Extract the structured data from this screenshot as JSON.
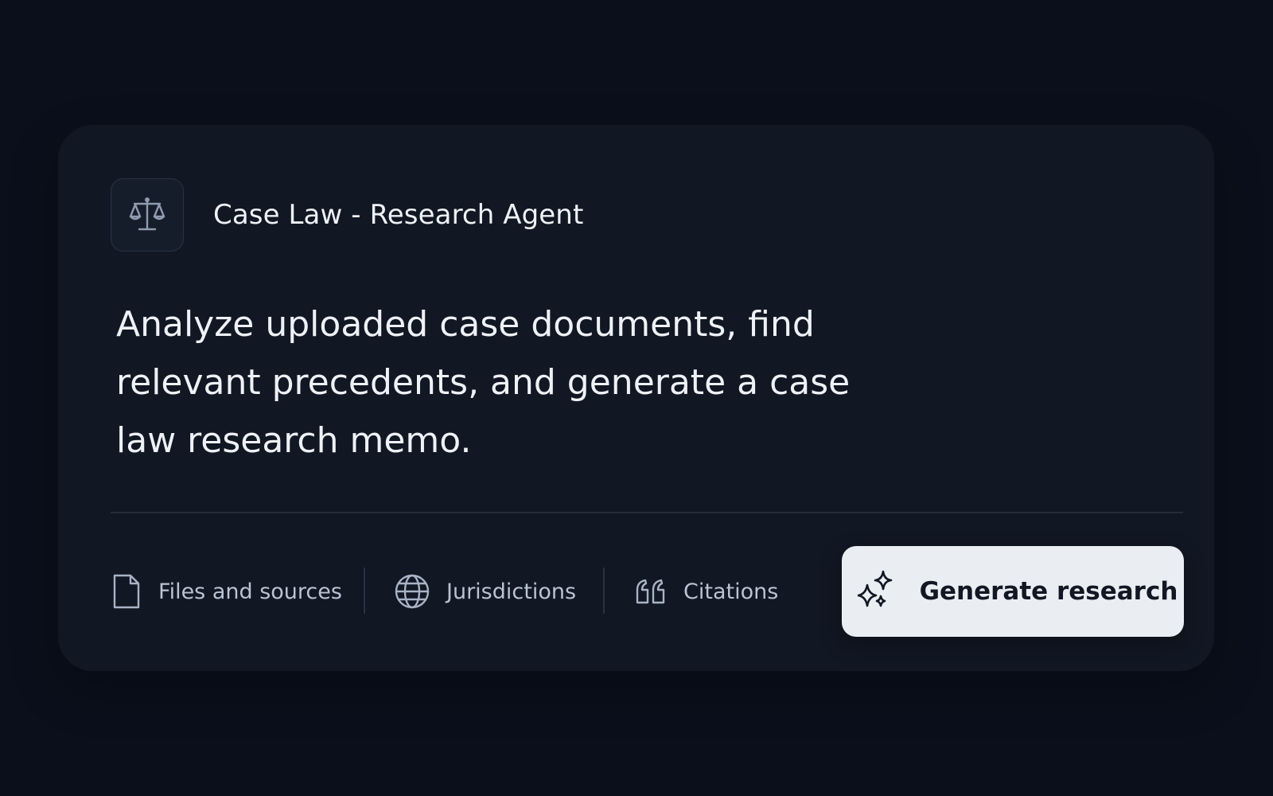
{
  "agent": {
    "icon": "scales-of-justice-icon",
    "title": "Case Law - Research Agent",
    "description": "Analyze uploaded case documents, find relevant precedents, and generate a case law research memo."
  },
  "toolbar": {
    "tools": [
      {
        "icon": "file-icon",
        "label": "Files and sources"
      },
      {
        "icon": "globe-icon",
        "label": "Jurisdictions"
      },
      {
        "icon": "quote-icon",
        "label": "Citations"
      }
    ],
    "generate_label": "Generate research",
    "generate_icon": "sparkles-icon"
  },
  "colors": {
    "background": "#0a0f1b",
    "card": "#111723",
    "button": "#eaedf2",
    "text_primary": "#eef1f6",
    "text_secondary": "#b9c3d2"
  }
}
